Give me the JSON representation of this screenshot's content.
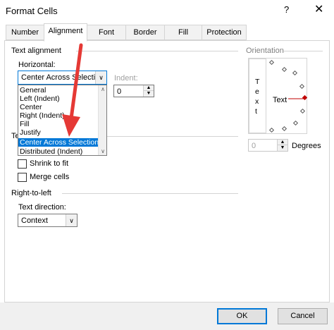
{
  "window": {
    "title": "Format Cells",
    "help_glyph": "?",
    "close_glyph": "✕"
  },
  "tabs": [
    {
      "label": "Number"
    },
    {
      "label": "Alignment"
    },
    {
      "label": "Font"
    },
    {
      "label": "Border"
    },
    {
      "label": "Fill"
    },
    {
      "label": "Protection"
    }
  ],
  "active_tab": "Alignment",
  "text_alignment": {
    "section_label": "Text alignment",
    "horizontal_label": "Horizontal:",
    "horizontal_value": "Center Across Selection",
    "horizontal_options": [
      "General",
      "Left (Indent)",
      "Center",
      "Right (Indent)",
      "Fill",
      "Justify",
      "Center Across Selection",
      "Distributed (Indent)"
    ],
    "selected_option": "Center Across Selection",
    "indent_label": "Indent:",
    "indent_value": "0",
    "partial_label": "Te"
  },
  "text_control": {
    "shrink_to_fit": {
      "label": "Shrink to fit",
      "checked": false
    },
    "merge_cells": {
      "label": "Merge cells",
      "checked": false
    }
  },
  "right_to_left": {
    "section_label": "Right-to-left",
    "direction_label": "Text direction:",
    "direction_value": "Context"
  },
  "orientation": {
    "section_label": "Orientation",
    "vertical_letters": [
      "T",
      "e",
      "x",
      "t"
    ],
    "dial_label": "Text",
    "degrees_value": "0",
    "degrees_label": "Degrees"
  },
  "buttons": {
    "ok": "OK",
    "cancel": "Cancel"
  },
  "annotation_color": "#e53935",
  "accent_color": "#0078d7"
}
